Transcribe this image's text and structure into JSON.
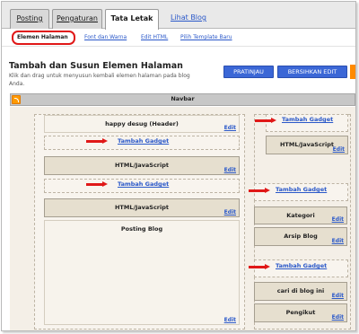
{
  "tabs": [
    {
      "label": "Posting"
    },
    {
      "label": "Pengaturan"
    },
    {
      "label": "Tata Letak"
    },
    {
      "label": "Lihat Blog"
    }
  ],
  "subnav": [
    {
      "label": "Elemen Halaman"
    },
    {
      "label": "Font dan Warna"
    },
    {
      "label": "Edit HTML"
    },
    {
      "label": "Pilih Template Baru"
    }
  ],
  "page": {
    "title": "Tambah dan Susun Elemen Halaman",
    "description": "Klik dan drag untuk menyusun kembali elemen halaman pada blog Anda."
  },
  "buttons": {
    "preview": "PRATINJAU",
    "clear": "BERSIHKAN EDIT"
  },
  "navbar": {
    "label": "Navbar"
  },
  "main": {
    "header_title": "happy desug (Header)",
    "add_gadget_1": "Tambah Gadget",
    "html1_title": "HTML/JavaScript",
    "add_gadget_2": "Tambah Gadget",
    "html2_title": "HTML/JavaScript",
    "posting_title": "Posting Blog"
  },
  "sidebar": {
    "add_gadget_1": "Tambah Gadget",
    "html_title": "HTML/JavaScript",
    "add_gadget_2": "Tambah Gadget",
    "kategori": "Kategori",
    "arsip": "Arsip Blog",
    "add_gadget_3": "Tambah Gadget",
    "cari": "cari di blog ini",
    "pengikut": "Pengikut"
  },
  "edit_label": "Edit",
  "colors": {
    "accent_blue": "#3b67d6",
    "link_blue": "#2a58c9",
    "highlight_red": "#e01818",
    "orange": "#ff9a00"
  }
}
